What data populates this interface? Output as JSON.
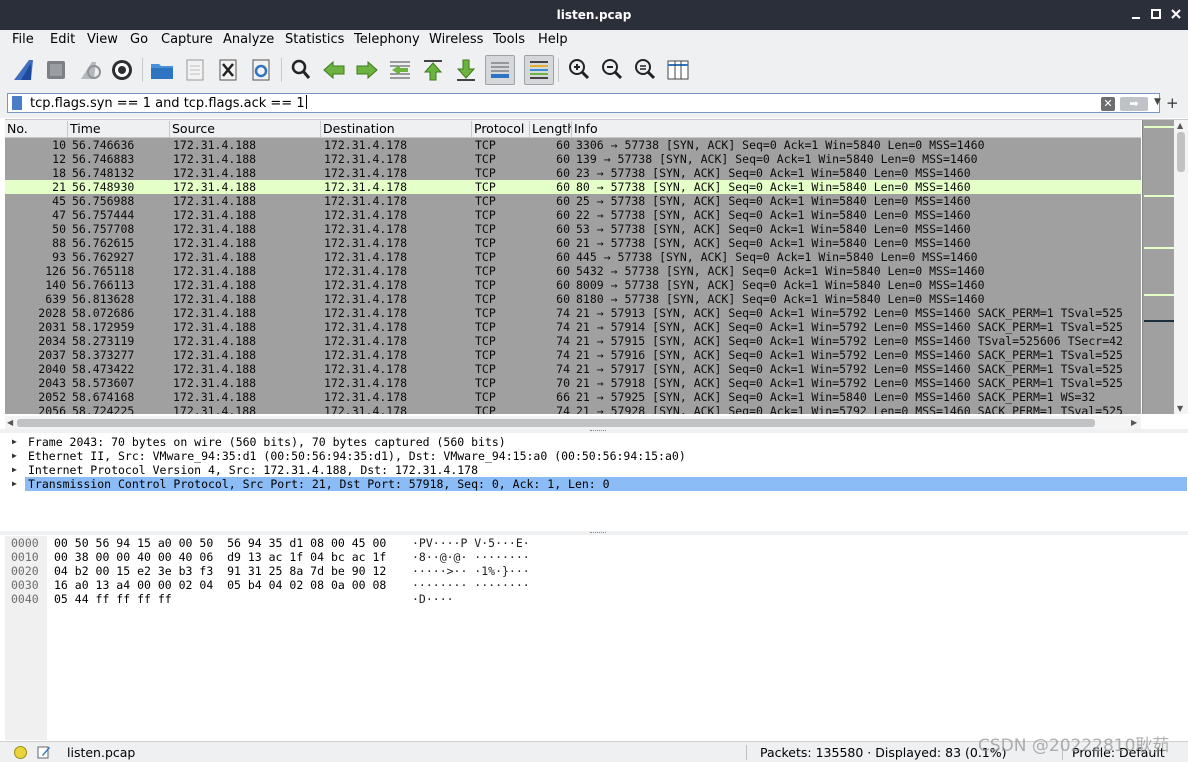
{
  "window": {
    "title": "listen.pcap"
  },
  "menu": [
    "File",
    "Edit",
    "View",
    "Go",
    "Capture",
    "Analyze",
    "Statistics",
    "Telephony",
    "Wireless",
    "Tools",
    "Help"
  ],
  "filter": {
    "value": "tcp.flags.syn == 1 and tcp.flags.ack == 1"
  },
  "packet_list": {
    "columns": [
      "No.",
      "Time",
      "Source",
      "Destination",
      "Protocol",
      "Length",
      "Info"
    ],
    "rows": [
      {
        "no": "10",
        "time": "56.746636",
        "src": "172.31.4.188",
        "dst": "172.31.4.178",
        "proto": "TCP",
        "len": "60",
        "info": "3306 → 57738 [SYN, ACK] Seq=0 Ack=1 Win=5840 Len=0 MSS=1460"
      },
      {
        "no": "12",
        "time": "56.746883",
        "src": "172.31.4.188",
        "dst": "172.31.4.178",
        "proto": "TCP",
        "len": "60",
        "info": "139 → 57738 [SYN, ACK] Seq=0 Ack=1 Win=5840 Len=0 MSS=1460"
      },
      {
        "no": "18",
        "time": "56.748132",
        "src": "172.31.4.188",
        "dst": "172.31.4.178",
        "proto": "TCP",
        "len": "60",
        "info": "23 → 57738 [SYN, ACK] Seq=0 Ack=1 Win=5840 Len=0 MSS=1460"
      },
      {
        "no": "21",
        "time": "56.748930",
        "src": "172.31.4.188",
        "dst": "172.31.4.178",
        "proto": "TCP",
        "len": "60",
        "info": "80 → 57738 [SYN, ACK] Seq=0 Ack=1 Win=5840 Len=0 MSS=1460",
        "selected": true
      },
      {
        "no": "45",
        "time": "56.756988",
        "src": "172.31.4.188",
        "dst": "172.31.4.178",
        "proto": "TCP",
        "len": "60",
        "info": "25 → 57738 [SYN, ACK] Seq=0 Ack=1 Win=5840 Len=0 MSS=1460"
      },
      {
        "no": "47",
        "time": "56.757444",
        "src": "172.31.4.188",
        "dst": "172.31.4.178",
        "proto": "TCP",
        "len": "60",
        "info": "22 → 57738 [SYN, ACK] Seq=0 Ack=1 Win=5840 Len=0 MSS=1460"
      },
      {
        "no": "50",
        "time": "56.757708",
        "src": "172.31.4.188",
        "dst": "172.31.4.178",
        "proto": "TCP",
        "len": "60",
        "info": "53 → 57738 [SYN, ACK] Seq=0 Ack=1 Win=5840 Len=0 MSS=1460"
      },
      {
        "no": "88",
        "time": "56.762615",
        "src": "172.31.4.188",
        "dst": "172.31.4.178",
        "proto": "TCP",
        "len": "60",
        "info": "21 → 57738 [SYN, ACK] Seq=0 Ack=1 Win=5840 Len=0 MSS=1460"
      },
      {
        "no": "93",
        "time": "56.762927",
        "src": "172.31.4.188",
        "dst": "172.31.4.178",
        "proto": "TCP",
        "len": "60",
        "info": "445 → 57738 [SYN, ACK] Seq=0 Ack=1 Win=5840 Len=0 MSS=1460"
      },
      {
        "no": "126",
        "time": "56.765118",
        "src": "172.31.4.188",
        "dst": "172.31.4.178",
        "proto": "TCP",
        "len": "60",
        "info": "5432 → 57738 [SYN, ACK] Seq=0 Ack=1 Win=5840 Len=0 MSS=1460"
      },
      {
        "no": "140",
        "time": "56.766113",
        "src": "172.31.4.188",
        "dst": "172.31.4.178",
        "proto": "TCP",
        "len": "60",
        "info": "8009 → 57738 [SYN, ACK] Seq=0 Ack=1 Win=5840 Len=0 MSS=1460"
      },
      {
        "no": "639",
        "time": "56.813628",
        "src": "172.31.4.188",
        "dst": "172.31.4.178",
        "proto": "TCP",
        "len": "60",
        "info": "8180 → 57738 [SYN, ACK] Seq=0 Ack=1 Win=5840 Len=0 MSS=1460"
      },
      {
        "no": "2028",
        "time": "58.072686",
        "src": "172.31.4.188",
        "dst": "172.31.4.178",
        "proto": "TCP",
        "len": "74",
        "info": "21 → 57913 [SYN, ACK] Seq=0 Ack=1 Win=5792 Len=0 MSS=1460 SACK_PERM=1 TSval=525"
      },
      {
        "no": "2031",
        "time": "58.172959",
        "src": "172.31.4.188",
        "dst": "172.31.4.178",
        "proto": "TCP",
        "len": "74",
        "info": "21 → 57914 [SYN, ACK] Seq=0 Ack=1 Win=5792 Len=0 MSS=1460 SACK_PERM=1 TSval=525"
      },
      {
        "no": "2034",
        "time": "58.273119",
        "src": "172.31.4.188",
        "dst": "172.31.4.178",
        "proto": "TCP",
        "len": "74",
        "info": "21 → 57915 [SYN, ACK] Seq=0 Ack=1 Win=5792 Len=0 MSS=1460 TSval=525606 TSecr=42"
      },
      {
        "no": "2037",
        "time": "58.373277",
        "src": "172.31.4.188",
        "dst": "172.31.4.178",
        "proto": "TCP",
        "len": "74",
        "info": "21 → 57916 [SYN, ACK] Seq=0 Ack=1 Win=5792 Len=0 MSS=1460 SACK_PERM=1 TSval=525"
      },
      {
        "no": "2040",
        "time": "58.473422",
        "src": "172.31.4.188",
        "dst": "172.31.4.178",
        "proto": "TCP",
        "len": "74",
        "info": "21 → 57917 [SYN, ACK] Seq=0 Ack=1 Win=5792 Len=0 MSS=1460 SACK_PERM=1 TSval=525"
      },
      {
        "no": "2043",
        "time": "58.573607",
        "src": "172.31.4.188",
        "dst": "172.31.4.178",
        "proto": "TCP",
        "len": "70",
        "info": "21 → 57918 [SYN, ACK] Seq=0 Ack=1 Win=5792 Len=0 MSS=1460 SACK_PERM=1 TSval=525"
      },
      {
        "no": "2052",
        "time": "58.674168",
        "src": "172.31.4.188",
        "dst": "172.31.4.178",
        "proto": "TCP",
        "len": "66",
        "info": "21 → 57925 [SYN, ACK] Seq=0 Ack=1 Win=5840 Len=0 MSS=1460 SACK_PERM=1 WS=32"
      },
      {
        "no": "2056",
        "time": "58.724225",
        "src": "172.31.4.188",
        "dst": "172.31.4.178",
        "proto": "TCP",
        "len": "74",
        "info": "21 → 57928 [SYN, ACK] Seq=0 Ack=1 Win=5792 Len=0 MSS=1460 SACK_PERM=1 TSval=525"
      }
    ]
  },
  "details": [
    {
      "text": "Frame 2043: 70 bytes on wire (560 bits), 70 bytes captured (560 bits)"
    },
    {
      "text": "Ethernet II, Src: VMware_94:35:d1 (00:50:56:94:35:d1), Dst: VMware_94:15:a0 (00:50:56:94:15:a0)"
    },
    {
      "text": "Internet Protocol Version 4, Src: 172.31.4.188, Dst: 172.31.4.178"
    },
    {
      "text": "Transmission Control Protocol, Src Port: 21, Dst Port: 57918, Seq: 0, Ack: 1, Len: 0",
      "selected": true
    }
  ],
  "bytes": [
    {
      "offset": "0000",
      "hex": "00 50 56 94 15 a0 00 50  56 94 35 d1 08 00 45 00",
      "ascii": "·PV····P V·5···E·"
    },
    {
      "offset": "0010",
      "hex": "00 38 00 00 40 00 40 06  d9 13 ac 1f 04 bc ac 1f",
      "ascii": "·8··@·@· ········"
    },
    {
      "offset": "0020",
      "hex": "04 b2 00 15 e2 3e b3 f3  91 31 25 8a 7d be 90 12",
      "ascii": "·····>·· ·1%·}···"
    },
    {
      "offset": "0030",
      "hex": "16 a0 13 a4 00 00 02 04  05 b4 04 02 08 0a 00 08",
      "ascii": "········ ········"
    },
    {
      "offset": "0040",
      "hex": "05 44 ff ff ff ff",
      "ascii": "·D····"
    }
  ],
  "status": {
    "file": "listen.pcap",
    "packets": "Packets: 135580 · Displayed: 83 (0.1%)",
    "profile": "Profile: Default"
  },
  "watermark": "CSDN @20222810耿茹"
}
